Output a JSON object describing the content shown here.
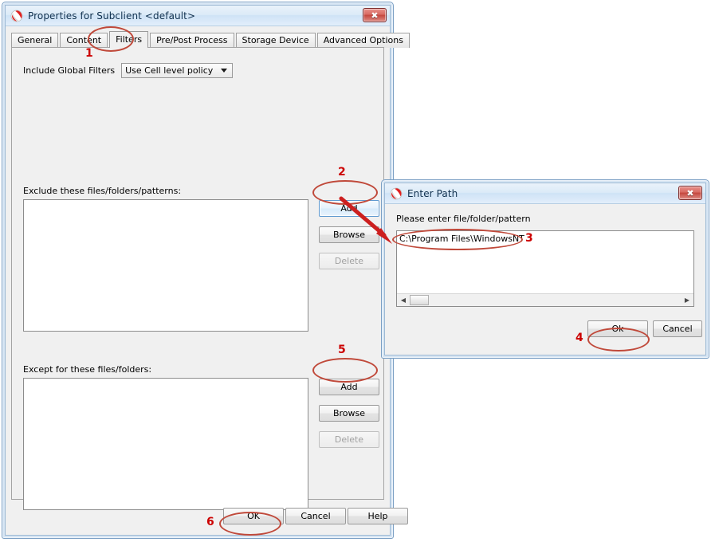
{
  "background_color": "#ffffff",
  "accent_color": "#cc0000",
  "annotation_ellipse_color": "#c0493a",
  "main_window": {
    "icon": "commvault-logo-icon",
    "title": "Properties for Subclient <default>",
    "close_label": "✖",
    "tabs": [
      {
        "label": "General",
        "active": false
      },
      {
        "label": "Content",
        "active": false
      },
      {
        "label": "Filters",
        "active": true
      },
      {
        "label": "Pre/Post Process",
        "active": false
      },
      {
        "label": "Storage Device",
        "active": false
      },
      {
        "label": "Advanced Options",
        "active": false
      }
    ],
    "global_filters": {
      "label": "Include Global Filters",
      "value": "Use Cell level policy"
    },
    "exclude_section": {
      "label": "Exclude these files/folders/patterns:",
      "items": [],
      "buttons": [
        {
          "label": "Add",
          "state": "focused"
        },
        {
          "label": "Browse",
          "state": "normal"
        },
        {
          "label": "Delete",
          "state": "disabled"
        }
      ]
    },
    "except_section": {
      "label": "Except for these files/folders:",
      "items": [],
      "buttons": [
        {
          "label": "Add",
          "state": "normal"
        },
        {
          "label": "Browse",
          "state": "normal"
        },
        {
          "label": "Delete",
          "state": "disabled"
        }
      ]
    },
    "footer_buttons": [
      {
        "label": "OK"
      },
      {
        "label": "Cancel"
      },
      {
        "label": "Help"
      }
    ]
  },
  "path_dialog": {
    "icon": "commvault-logo-icon",
    "title": "Enter Path",
    "close_label": "✖",
    "prompt": "Please enter file/folder/pattern",
    "input_value": "C:\\Program Files\\WindowsNT",
    "scrollbar": {
      "left_arrow": "◀",
      "right_arrow": "▶"
    },
    "buttons": [
      {
        "label": "Ok"
      },
      {
        "label": "Cancel"
      }
    ]
  },
  "annotations": {
    "steps": [
      {
        "number": "1",
        "target": "filters-tab"
      },
      {
        "number": "2",
        "target": "exclude-add-button"
      },
      {
        "number": "3",
        "target": "path-input-value"
      },
      {
        "number": "4",
        "target": "path-ok-button"
      },
      {
        "number": "5",
        "target": "except-add-button"
      },
      {
        "number": "6",
        "target": "main-ok-button"
      }
    ]
  }
}
